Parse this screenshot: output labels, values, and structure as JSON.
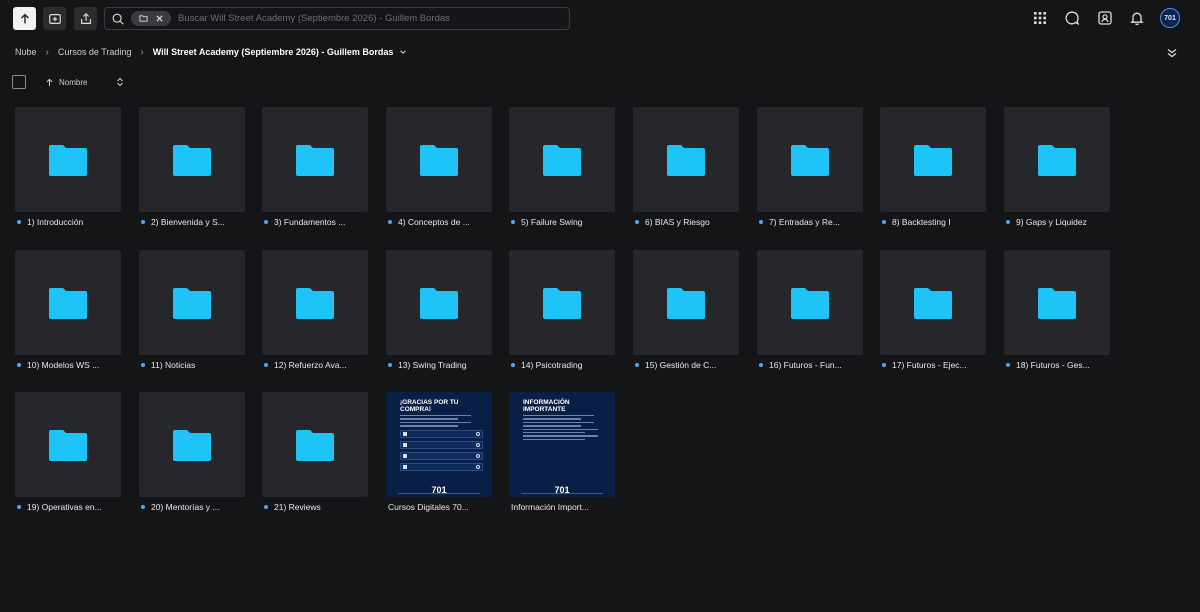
{
  "search": {
    "placeholder": "Buscar Will Street Academy (Septiembre 2026) - Guillem Bordas"
  },
  "user": {
    "avatar_text": "701"
  },
  "breadcrumb": {
    "items": [
      "Nube",
      "Cursos de Trading"
    ],
    "current": "Will Street Academy (Septiembre 2026) - Guillem Bordas"
  },
  "sort": {
    "label": "Nombre"
  },
  "colors": {
    "accent": "#1ec4f7",
    "dot": "#4aa8ff",
    "background": "#141516",
    "tile": "#26272a"
  },
  "items": [
    {
      "label": "1) Introducción",
      "type": "folder"
    },
    {
      "label": "2) Bienvenida y S...",
      "type": "folder"
    },
    {
      "label": "3) Fundamentos ...",
      "type": "folder"
    },
    {
      "label": "4) Conceptos de ...",
      "type": "folder"
    },
    {
      "label": "5) Failure Swing",
      "type": "folder"
    },
    {
      "label": "6) BIAS y Riesgo",
      "type": "folder"
    },
    {
      "label": "7) Entradas y Re...",
      "type": "folder"
    },
    {
      "label": "8) Backtesting I",
      "type": "folder"
    },
    {
      "label": "9) Gaps y Liquidez",
      "type": "folder"
    },
    {
      "label": "10) Modelos WS ...",
      "type": "folder"
    },
    {
      "label": "11) Noticias",
      "type": "folder"
    },
    {
      "label": "12) Refuerzo Ava...",
      "type": "folder"
    },
    {
      "label": "13) Swing Trading",
      "type": "folder"
    },
    {
      "label": "14) Psicotrading",
      "type": "folder"
    },
    {
      "label": "15) Gestión de C...",
      "type": "folder"
    },
    {
      "label": "16) Futuros - Fun...",
      "type": "folder"
    },
    {
      "label": "17) Futuros - Ejec...",
      "type": "folder"
    },
    {
      "label": "18) Futuros - Ges...",
      "type": "folder"
    },
    {
      "label": "19) Operativas en...",
      "type": "folder"
    },
    {
      "label": "20) Mentorías y ...",
      "type": "folder"
    },
    {
      "label": "21) Reviews",
      "type": "folder"
    },
    {
      "label": "Cursos Digitales 70...",
      "type": "image",
      "thumb_title": "¡GRACIAS POR TU COMPRA!",
      "thumb_brand": "701"
    },
    {
      "label": "Información Import...",
      "type": "image",
      "thumb_title": "INFORMACIÓN IMPORTANTE",
      "thumb_brand": "701"
    }
  ]
}
